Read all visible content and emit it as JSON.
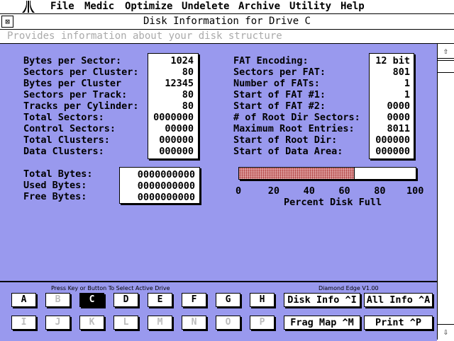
{
  "menubar": {
    "items": [
      "File",
      "Medic",
      "Optimize",
      "Undelete",
      "Archive",
      "Utility",
      "Help"
    ]
  },
  "window": {
    "title": "Disk Information for Drive C",
    "close_glyph": "⊠",
    "info_line": "Provides information about your disk structure"
  },
  "left_stats": [
    {
      "label": "Bytes per Sector:",
      "value": "1024"
    },
    {
      "label": "Sectors per Cluster:",
      "value": "80"
    },
    {
      "label": "Bytes per Cluster",
      "value": "12345"
    },
    {
      "label": "Sectors per Track:",
      "value": "80"
    },
    {
      "label": "Tracks per Cylinder:",
      "value": "80"
    },
    {
      "label": "Total Sectors:",
      "value": "0000000"
    },
    {
      "label": "Control Sectors:",
      "value": "00000"
    },
    {
      "label": "Total Clusters:",
      "value": "000000"
    },
    {
      "label": "Data Clusters:",
      "value": "000000"
    }
  ],
  "right_stats": [
    {
      "label": "FAT Encoding:",
      "value": "12 bit"
    },
    {
      "label": "Sectors per FAT:",
      "value": "801"
    },
    {
      "label": "Number of FATs:",
      "value": "1"
    },
    {
      "label": "Start of FAT #1:",
      "value": "1"
    },
    {
      "label": "Start of FAT #2:",
      "value": "0000"
    },
    {
      "label": "# of Root Dir Sectors:",
      "value": "0000"
    },
    {
      "label": "Maximum Root Entries:",
      "value": "8011"
    },
    {
      "label": "Start of Root Dir:",
      "value": "000000"
    },
    {
      "label": "Start of Data Area:",
      "value": "000000"
    }
  ],
  "bytes_stats": [
    {
      "label": "Total Bytes:",
      "value": "0000000000"
    },
    {
      "label": "Used Bytes:",
      "value": "0000000000"
    },
    {
      "label": "Free Bytes:",
      "value": "0000000000"
    }
  ],
  "disk_full": {
    "percent": 65,
    "ticks": [
      "0",
      "20",
      "40",
      "60",
      "80",
      "100"
    ],
    "caption": "Percent Disk Full",
    "fill_color": "#e0a0a0"
  },
  "bottom": {
    "hint": "Press Key or Button To Select Active Drive",
    "version": "Diamond Edge V1.00",
    "drives_row1": [
      {
        "label": "A",
        "state": "normal"
      },
      {
        "label": "B",
        "state": "dim"
      },
      {
        "label": "C",
        "state": "selected"
      },
      {
        "label": "D",
        "state": "normal"
      },
      {
        "label": "E",
        "state": "normal"
      },
      {
        "label": "F",
        "state": "normal"
      },
      {
        "label": "G",
        "state": "normal"
      },
      {
        "label": "H",
        "state": "normal"
      }
    ],
    "drives_row2": [
      {
        "label": "I",
        "state": "dim"
      },
      {
        "label": "J",
        "state": "dim"
      },
      {
        "label": "K",
        "state": "dim"
      },
      {
        "label": "L",
        "state": "dim"
      },
      {
        "label": "M",
        "state": "dim"
      },
      {
        "label": "N",
        "state": "dim"
      },
      {
        "label": "O",
        "state": "dim"
      },
      {
        "label": "P",
        "state": "dim"
      }
    ],
    "commands": {
      "disk_info": "Disk Info ^I",
      "all_info": "All Info ^A",
      "frag_map": "Frag Map ^M",
      "print": "Print ^P"
    }
  },
  "scrollbar": {
    "up_glyph": "⇧",
    "down_glyph": "⇩"
  },
  "colors": {
    "panel": "#9999ee",
    "dim_text": "#bbbbbb",
    "info_text": "#aaaaaa"
  }
}
